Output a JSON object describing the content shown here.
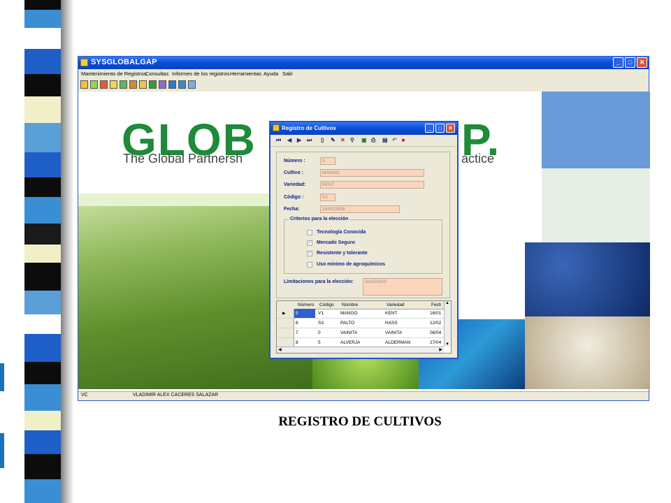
{
  "app": {
    "title": "SYSGLOBALGAP",
    "menu": [
      "Mantenimiento de Registros",
      "Consultas",
      "Informes de los registros",
      "Herramientas",
      "Ayuda",
      "Salir"
    ],
    "window_buttons": {
      "minimize": "_",
      "maximize": "□",
      "close": "✕"
    },
    "status": {
      "left": "VC",
      "user": "VLADIMIR ALEX CACERES SALAZAR"
    }
  },
  "banner": {
    "logo": "GLOB",
    "logo_tail": "P.",
    "subtitle_left": "The Global Partnersh",
    "subtitle_right": "actice"
  },
  "dialog": {
    "title": "Registro de Cultivos",
    "fields": {
      "numero": {
        "label": "Número :",
        "value": "5"
      },
      "cultivo": {
        "label": "Cultivo :",
        "value": "MANGO"
      },
      "variedad": {
        "label": "Variedad:",
        "value": "KENT"
      },
      "codigo": {
        "label": "Código :",
        "value": "V1"
      },
      "fecha": {
        "label": "Fecha:",
        "value": "16/01/2008"
      }
    },
    "criteria": {
      "title": "Criterios para la elección",
      "items": [
        {
          "label": "Tecnología Conocida",
          "checked": false
        },
        {
          "label": "Mercado Seguro",
          "checked": true
        },
        {
          "label": "Resistente y tolerante",
          "checked": true
        },
        {
          "label": "Uso mínimo de agroquímicos",
          "checked": false
        }
      ]
    },
    "limitations": {
      "label": "Limitaciones para la elección:",
      "value": "SASDADS"
    },
    "grid": {
      "columns": [
        "Número",
        "Código",
        "Nombre",
        "Variedad",
        "Fech"
      ],
      "rows": [
        [
          "5",
          "V1",
          "MANGO",
          "KENT",
          "16/01"
        ],
        [
          "6",
          "S3",
          "PALTO",
          "HASS",
          "12/02"
        ],
        [
          "7",
          "0",
          "VAINITA",
          "VAINITA",
          "06/04"
        ],
        [
          "8",
          "5",
          "ALVERJA",
          "ALDERMAN",
          "27/04"
        ]
      ],
      "current_row_marker": "▶"
    }
  },
  "caption": "REGISTRO DE CULTIVOS"
}
